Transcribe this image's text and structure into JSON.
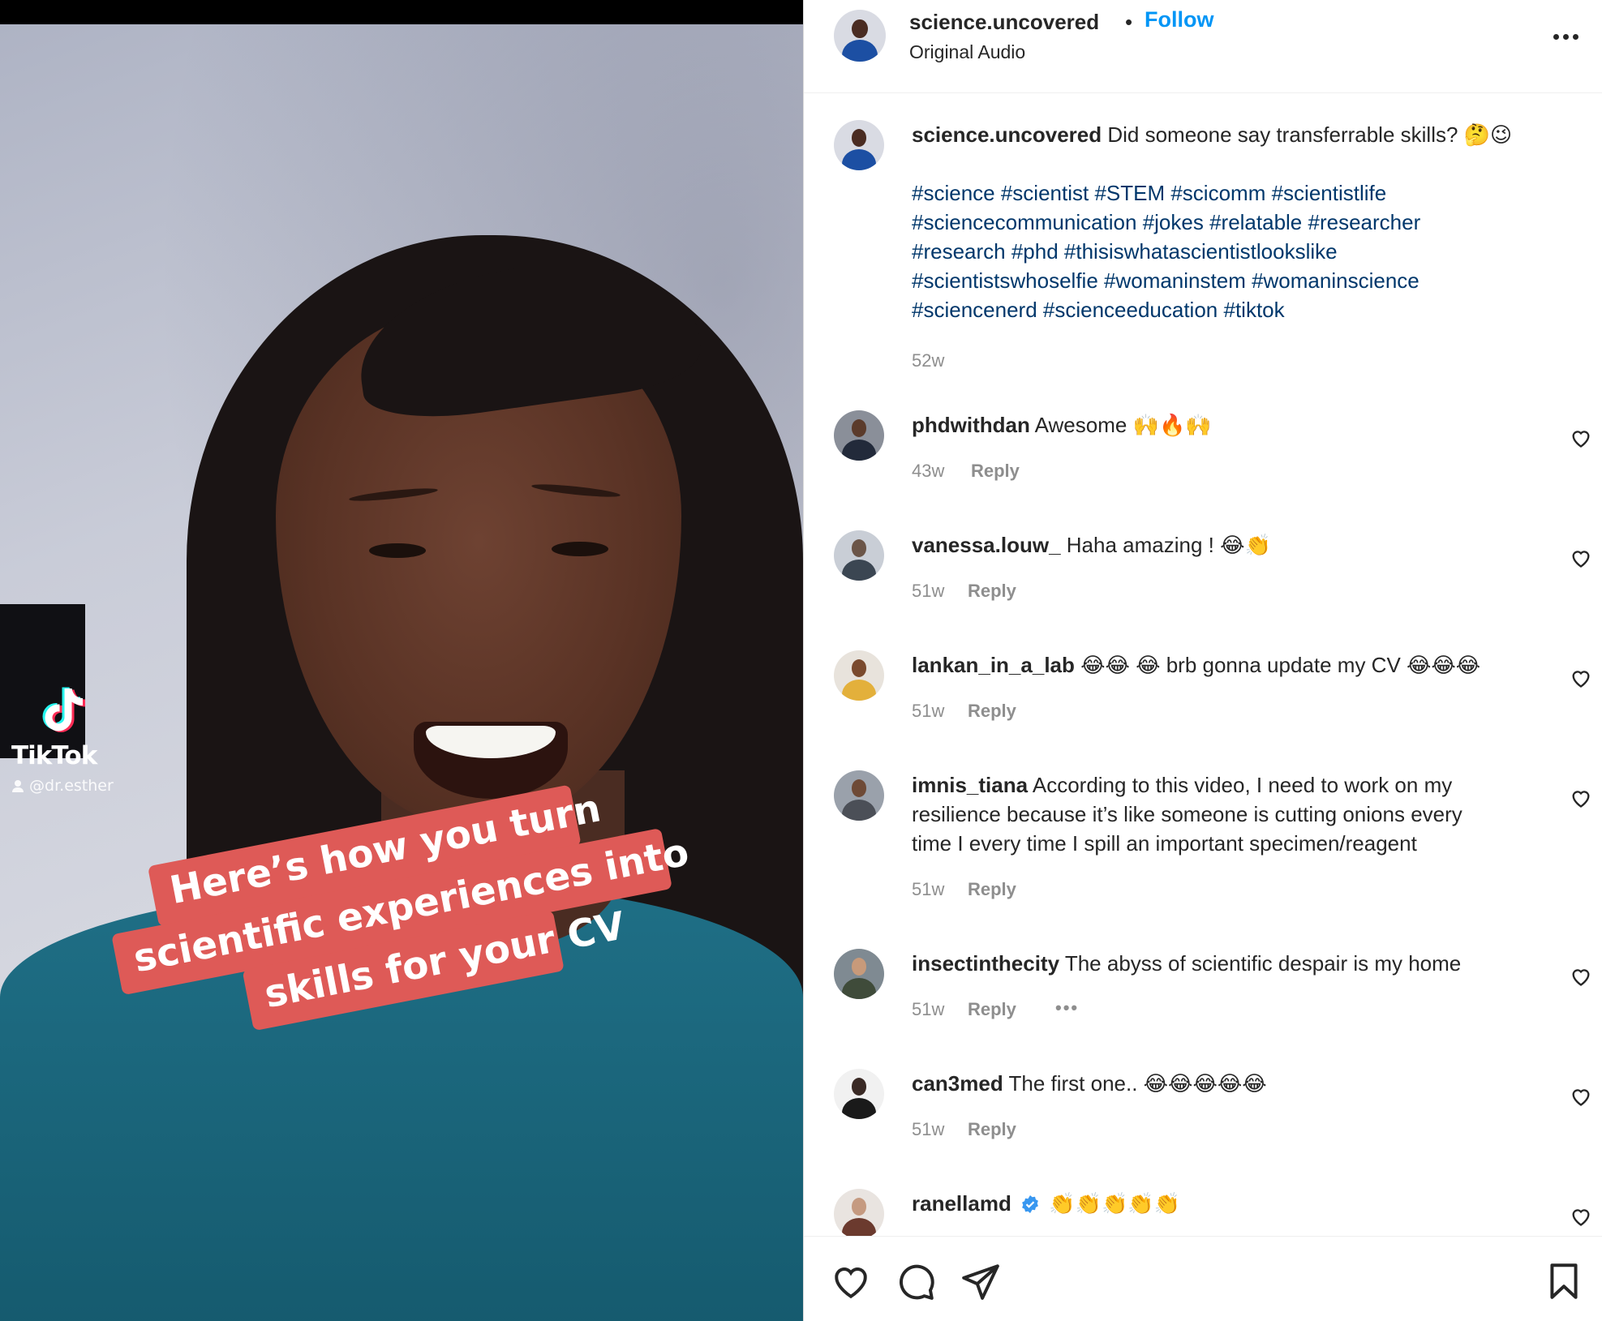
{
  "video": {
    "tiktok_brand": "TikTok",
    "tiktok_handle": "@dr.esther",
    "caption_lines": [
      "Here’s how you turn",
      "scientific experiences into",
      "skills for your CV"
    ]
  },
  "header": {
    "username": "science.uncovered",
    "separator": "•",
    "follow_label": "Follow",
    "audio_label": "Original Audio"
  },
  "post": {
    "username": "science.uncovered",
    "caption": "Did someone say transferrable skills? 🤔😉",
    "hashtags": [
      "#science #scientist #STEM #scicomm #scientistlife",
      "#sciencecommunication #jokes #relatable #researcher",
      "#research #phd #thisiswhatascientistlookslike",
      "#scientistswhoselfie #womaninstem #womaninscience",
      "#sciencenerd #scienceeducation #tiktok"
    ],
    "age": "52w"
  },
  "comments": [
    {
      "username": "phdwithdan",
      "text": "Awesome 🙌🔥🙌",
      "age": "43w",
      "reply_label": "Reply"
    },
    {
      "username": "vanessa.louw_",
      "text": "Haha amazing ! 😂👏",
      "age": "51w",
      "reply_label": "Reply"
    },
    {
      "username": "lankan_in_a_lab",
      "text": "😂😂 😂 brb gonna update my CV 😂😂😂",
      "age": "51w",
      "reply_label": "Reply"
    },
    {
      "username": "imnis_tiana",
      "text_lines": [
        "According to this video, I need to work on my",
        "resilience because it’s like someone is cutting onions every",
        "time I every time I spill an important specimen/reagent"
      ],
      "age": "51w",
      "reply_label": "Reply"
    },
    {
      "username": "insectinthecity",
      "text": "The abyss of scientific despair is my home",
      "age": "51w",
      "reply_label": "Reply",
      "more": "•••"
    },
    {
      "username": "can3med",
      "text": "The first one.. 😂😂😂😂😂",
      "age": "51w",
      "reply_label": "Reply"
    },
    {
      "username": "ranellamd",
      "text": "👏👏👏👏👏",
      "verified": true
    }
  ],
  "colors": {
    "follow": "#0095f6",
    "hashtag": "#00376b",
    "muted": "#8e8e8e",
    "caption_bg": "#de5a57",
    "text": "#262626"
  },
  "icons": [
    "more-icon",
    "heart-icon",
    "comment-icon",
    "share-icon",
    "bookmark-icon",
    "verified-icon",
    "tiktok-logo-icon",
    "person-icon"
  ]
}
